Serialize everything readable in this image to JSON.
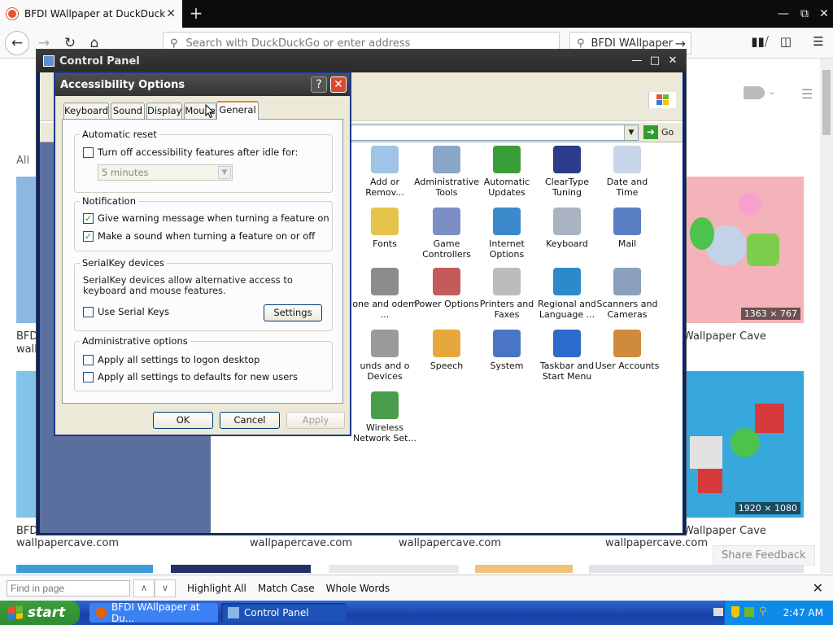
{
  "browser": {
    "tab_title": "BFDI WAllpaper at DuckDuckGo",
    "tab_close": "✕",
    "new_tab": "+",
    "url_placeholder": "Search with DuckDuckGo or enter address",
    "search_value": "BFDI WAllpaper"
  },
  "page": {
    "all_label": "All",
    "results": [
      {
        "title": "BFD",
        "domain": "wall"
      },
      {
        "title": "Wallpaper Cave",
        "domain": ""
      },
      {
        "title": "BFD",
        "domain": "wallpapercave.com"
      },
      {
        "title": "",
        "domain": "wallpapercave.com"
      },
      {
        "title": "",
        "domain": "wallpapercave.com"
      },
      {
        "title": "Wallpaper Cave",
        "domain": "wallpapercave.com"
      }
    ],
    "dims": [
      "1363 × 767",
      "1920 × 1080"
    ],
    "share_feedback": "Share Feedback"
  },
  "findbar": {
    "placeholder": "Find in page",
    "highlight_all": "Highlight All",
    "match_case": "Match Case",
    "whole_words": "Whole Words"
  },
  "taskbar": {
    "start": "start",
    "items": [
      "BFDI WAllpaper at Du...",
      "Control Panel"
    ],
    "clock": "2:47 AM"
  },
  "control_panel": {
    "title": "Control Panel",
    "go_label": "Go",
    "icons": [
      {
        "label": "Add or Remov...",
        "color": "#9fc4e8"
      },
      {
        "label": "Administrative Tools",
        "color": "#8aa6c9"
      },
      {
        "label": "Automatic Updates",
        "color": "#3a9d3a"
      },
      {
        "label": "ClearType Tuning",
        "color": "#2a3c8a"
      },
      {
        "label": "Date and Time",
        "color": "#c7d7ea"
      },
      {
        "label": "Fonts",
        "color": "#e6c34a"
      },
      {
        "label": "Game Controllers",
        "color": "#7c8fc4"
      },
      {
        "label": "Internet Options",
        "color": "#3c8acb"
      },
      {
        "label": "Keyboard",
        "color": "#aab3c2"
      },
      {
        "label": "Mail",
        "color": "#5a7fc4"
      },
      {
        "label": "one and odem ...",
        "color": "#8c8c8c"
      },
      {
        "label": "Power Options",
        "color": "#c45a5a"
      },
      {
        "label": "Printers and Faxes",
        "color": "#bcbcbc"
      },
      {
        "label": "Regional and Language ...",
        "color": "#2c8acb"
      },
      {
        "label": "Scanners and Cameras",
        "color": "#8aa0bd"
      },
      {
        "label": "unds and o Devices",
        "color": "#9a9a9a"
      },
      {
        "label": "Speech",
        "color": "#e6a83c"
      },
      {
        "label": "System",
        "color": "#4a74c4"
      },
      {
        "label": "Taskbar and Start Menu",
        "color": "#2c6acb"
      },
      {
        "label": "User Accounts",
        "color": "#d08a3c"
      },
      {
        "label": "Wireless Network Set...",
        "color": "#4a9d4a"
      }
    ]
  },
  "accessibility": {
    "title": "Accessibility Options",
    "tabs": [
      "Keyboard",
      "Sound",
      "Display",
      "Mouse",
      "General"
    ],
    "active_tab": "General",
    "auto_reset": {
      "caption": "Automatic reset",
      "option": "Turn off accessibility features after idle for:",
      "checked": false,
      "select_value": "5 minutes"
    },
    "notification": {
      "caption": "Notification",
      "options": [
        {
          "label": "Give warning message when turning a feature on",
          "checked": true
        },
        {
          "label": "Make a sound when turning a feature on or off",
          "checked": true
        }
      ]
    },
    "serialkey": {
      "caption": "SerialKey devices",
      "description": "SerialKey devices allow alternative access to keyboard and mouse features.",
      "option": "Use Serial Keys",
      "checked": false,
      "settings_label": "Settings"
    },
    "admin": {
      "caption": "Administrative options",
      "options": [
        {
          "label": "Apply all settings to logon desktop",
          "checked": false
        },
        {
          "label": "Apply all settings to defaults for new users",
          "checked": false
        }
      ]
    },
    "ok": "OK",
    "cancel": "Cancel",
    "apply": "Apply"
  }
}
